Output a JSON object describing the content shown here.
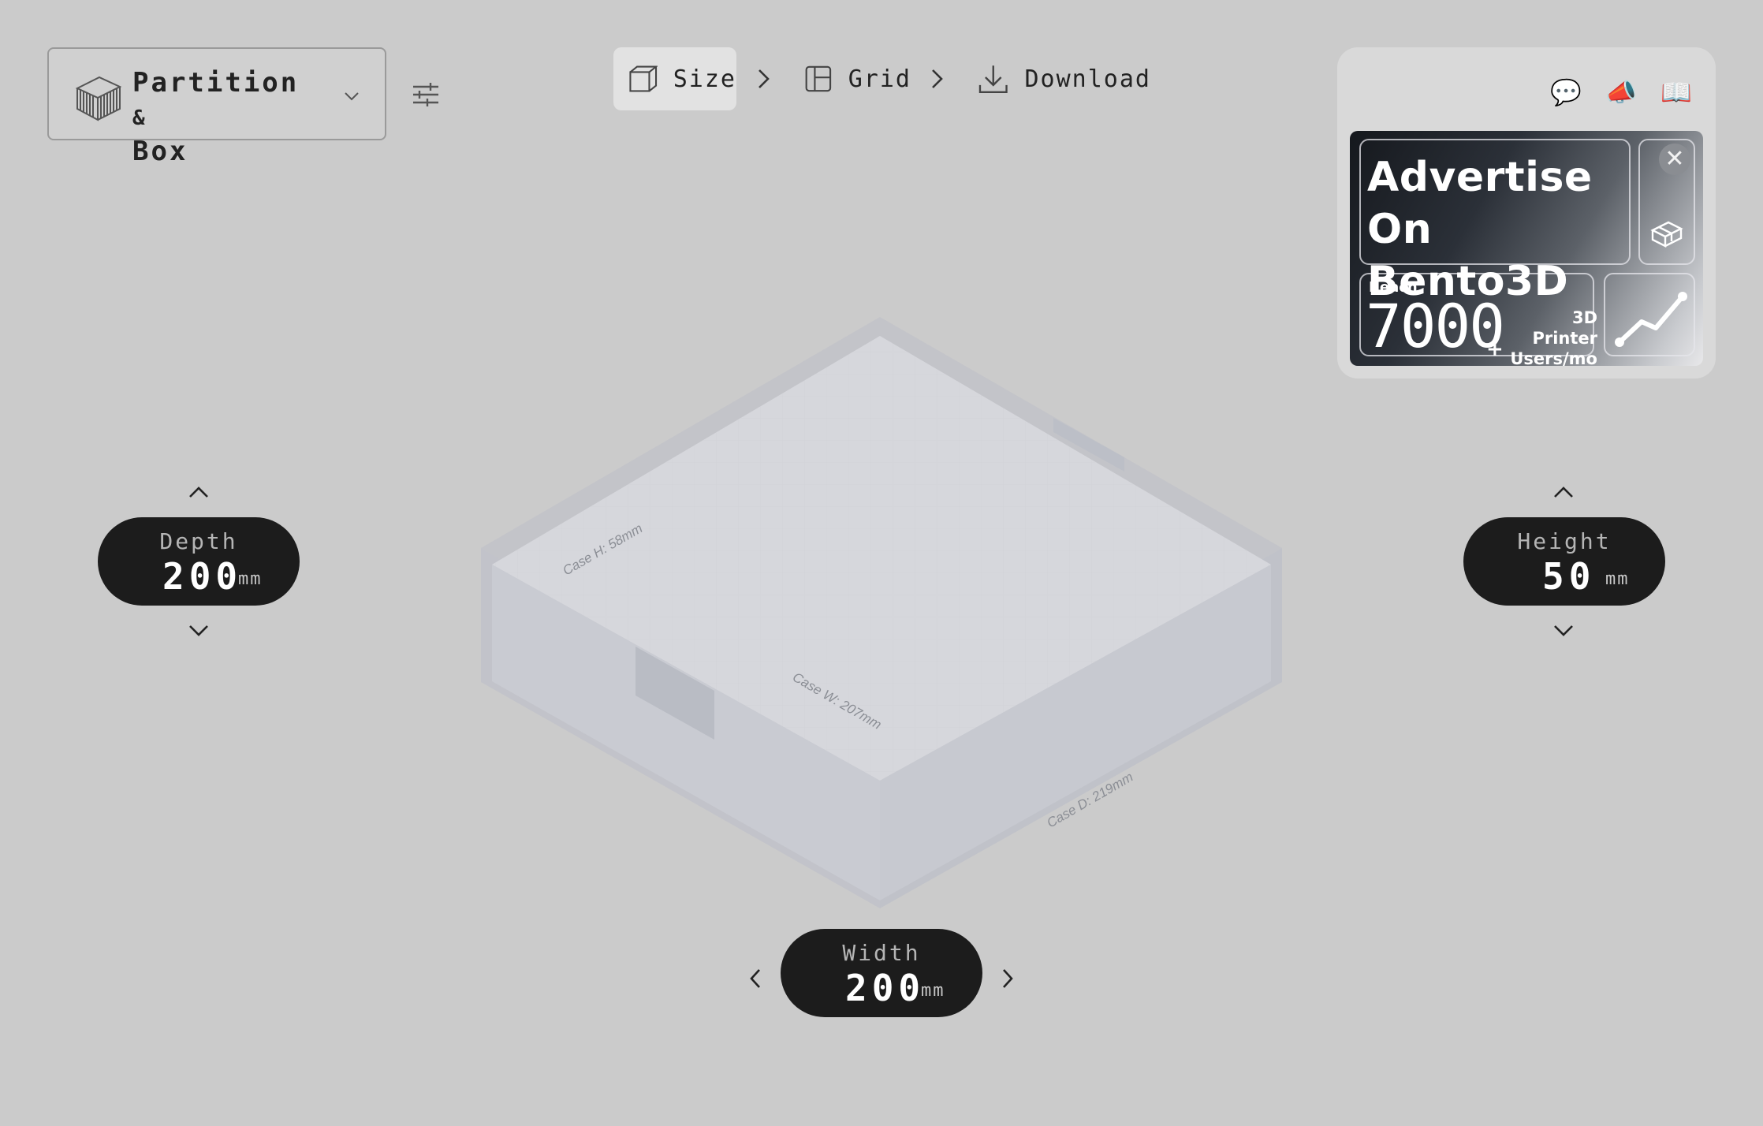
{
  "product": {
    "name_main": "Partition",
    "name_amp": "&",
    "name_second": "Box"
  },
  "steps": [
    {
      "label": "Size",
      "active": true
    },
    {
      "label": "Grid",
      "active": false
    },
    {
      "label": "Download",
      "active": false
    }
  ],
  "top_icons": {
    "chat": "💬",
    "announce": "📣",
    "docs": "📖"
  },
  "ad": {
    "headline_line1": "Advertise",
    "headline_line2": "On Bento3D",
    "reach_label": "Reach",
    "reach_number": "7000",
    "reach_plus": "+",
    "reach_desc_line1": "3D Printer",
    "reach_desc_line2": "Users/mo",
    "close_symbol": "✕"
  },
  "dimensions": {
    "depth": {
      "label": "Depth",
      "value": "200",
      "unit": "mm"
    },
    "height": {
      "label": "Height",
      "value": "50",
      "unit": "mm"
    },
    "width": {
      "label": "Width",
      "value": "200",
      "unit": "mm"
    }
  },
  "model_labels": {
    "case_h": "Case H:  58mm",
    "case_w": "Case W:  207mm",
    "case_d": "Case D:  219mm"
  },
  "colors": {
    "background": "#cbcbcb",
    "pill": "#1c1c1c",
    "active_step": "#e2e2e2",
    "model_top": "#d5d6da",
    "model_side": "#c7c9d0"
  }
}
